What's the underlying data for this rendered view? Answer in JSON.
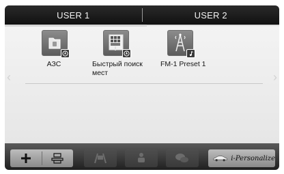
{
  "tabs": [
    {
      "label": "USER 1",
      "active": true
    },
    {
      "label": "USER 2",
      "active": false
    }
  ],
  "items": [
    {
      "label": "АЗС",
      "icon": "folder-icon",
      "badge": "navigation-badge-icon"
    },
    {
      "label": "Быстрый поиск мест",
      "icon": "quick-search-icon",
      "badge": "navigation-badge-icon"
    },
    {
      "label": "FM-1 Preset 1",
      "icon": "radio-tower-icon",
      "badge": "music-note-badge-icon"
    }
  ],
  "bottom_bar": {
    "add_icon": "plus-icon",
    "edit_icon": "edit-layout-icon",
    "disabled_icons": [
      "road-icon",
      "seat-icon",
      "chat-icon"
    ],
    "personalize_label": "i-Personalize",
    "personalize_icon": "car-icon"
  },
  "colors": {
    "tab_bar": "#1a1a1a",
    "content_bg": "#ececec",
    "bottom_bar": "#2e2e2e",
    "button_active": "#a8a8a8",
    "button_disabled": "#444444"
  }
}
